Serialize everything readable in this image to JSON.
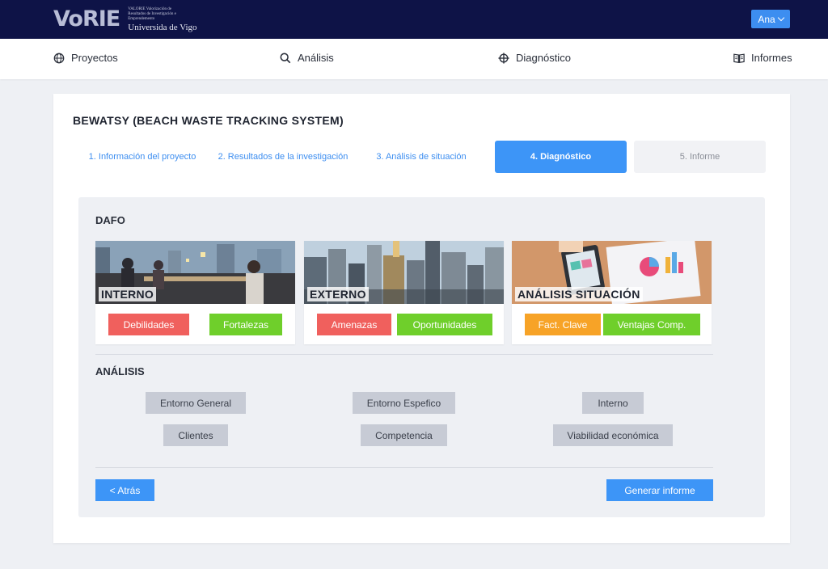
{
  "header": {
    "logo_text": "VoRIE",
    "logo_subtitle": "VALORIE Valorización de Resultados de Investigación e Emprendemento",
    "logo_university": "Universida de Vigo",
    "user_label": "Ana"
  },
  "nav": {
    "items": [
      {
        "label": "Proyectos",
        "icon": "globe-icon"
      },
      {
        "label": "Análisis",
        "icon": "search-icon"
      },
      {
        "label": "Diagnóstico",
        "icon": "crosshair-icon"
      },
      {
        "label": "Informes",
        "icon": "book-icon"
      }
    ]
  },
  "project": {
    "title": "BEWATSY (BEACH WASTE TRACKING SYSTEM)"
  },
  "steps": [
    {
      "label": "1. Información del proyecto",
      "state": "link"
    },
    {
      "label": "2. Resultados de la investigación",
      "state": "link"
    },
    {
      "label": "3. Análisis de situación",
      "state": "link"
    },
    {
      "label": "4. Diagnóstico",
      "state": "active"
    },
    {
      "label": "5. Informe",
      "state": "inactive"
    }
  ],
  "dafo": {
    "title": "DAFO",
    "cards": [
      {
        "label": "INTERNO",
        "buttons": [
          "Debilidades",
          "Fortalezas"
        ]
      },
      {
        "label": "EXTERNO",
        "buttons": [
          "Amenazas",
          "Oportunidades"
        ]
      },
      {
        "label": "ANÁLISIS SITUACIÓN",
        "buttons": [
          "Fact. Clave",
          "Ventajas Comp."
        ]
      }
    ]
  },
  "analisis": {
    "title": "ANÁLISIS",
    "buttons": [
      "Entorno General",
      "Entorno Espefico",
      "Interno",
      "Clientes",
      "Competencia",
      "Viabilidad económica"
    ]
  },
  "footer": {
    "back_label": "< Atrás",
    "generate_label": "Generar informe"
  },
  "colors": {
    "topbar": "#0e1347",
    "accent": "#3d95f7",
    "red": "#f0605d",
    "green": "#6fcf2b",
    "orange": "#f7a327"
  }
}
